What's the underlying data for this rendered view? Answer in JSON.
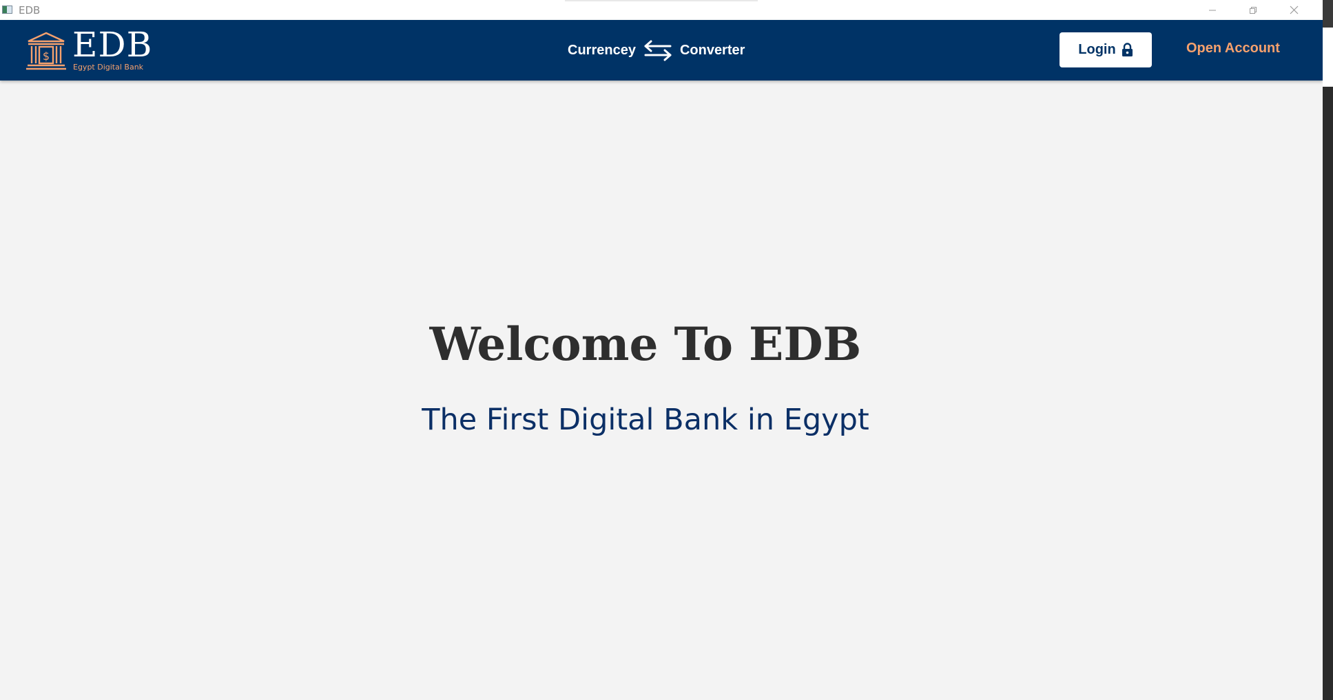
{
  "window": {
    "title": "EDB",
    "controls": {
      "minimize_icon": "minimize-icon",
      "restore_icon": "restore-icon",
      "close_icon": "close-icon"
    }
  },
  "navbar": {
    "background": "#003366",
    "logo": {
      "name": "EDB",
      "tagline": "Egypt Digital Bank",
      "icon": "bank-building-icon",
      "accent": "#F6A16D"
    },
    "converter": {
      "left_label": "Currencey",
      "icon": "swap-arrows-icon",
      "right_label": "Converter"
    },
    "login": {
      "label": "Login",
      "icon": "lock-icon"
    },
    "open_account": {
      "label": "Open Account",
      "color": "#F6A16D"
    }
  },
  "hero": {
    "title": "Welcome To EDB",
    "subtitle": "The First Digital Bank in Egypt"
  }
}
